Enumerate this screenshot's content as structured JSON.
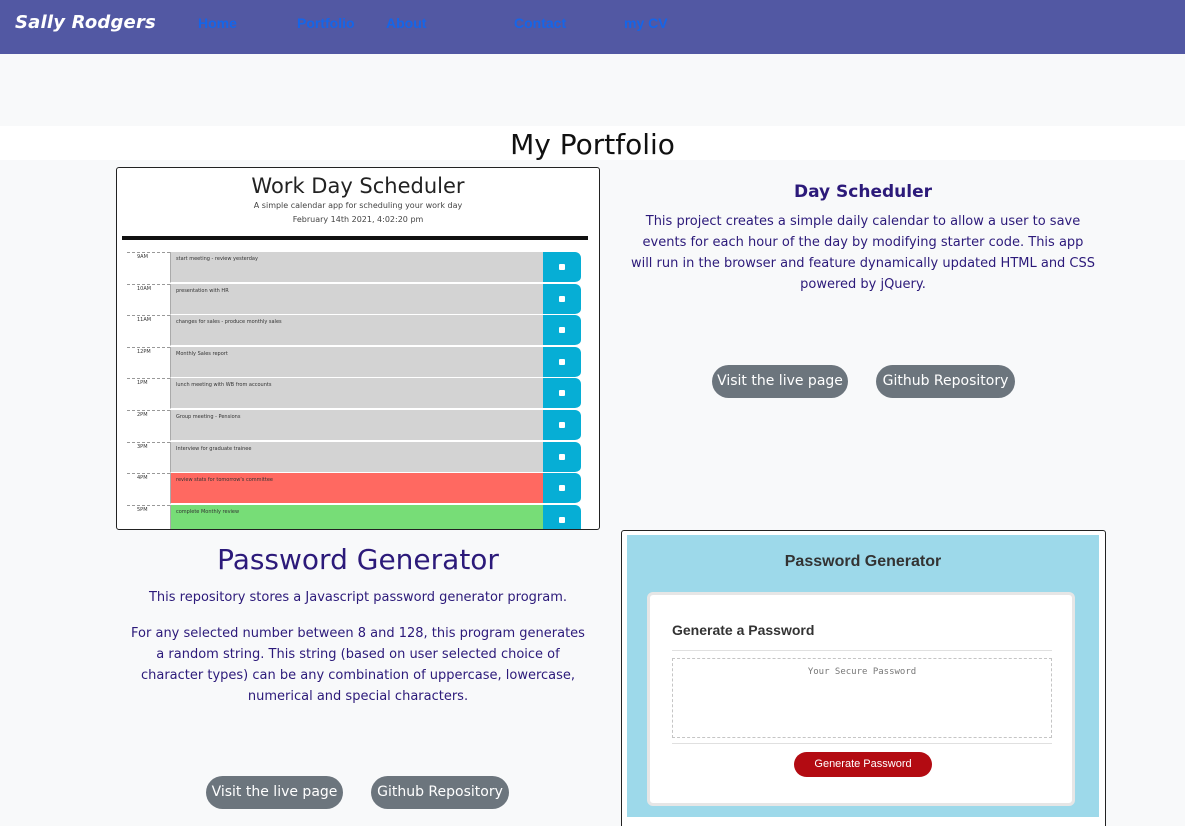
{
  "nav": {
    "brand": "Sally Rodgers",
    "links": [
      "Home",
      "Portfolio",
      "About",
      "Contact",
      "my CV"
    ]
  },
  "page": {
    "title": "My Portfolio"
  },
  "scheduler_preview": {
    "title": "Work Day Scheduler",
    "subtitle": "A simple calendar app for scheduling your work day",
    "date": "February 14th 2021, 4:02:20 pm",
    "rows": [
      {
        "hour": "9AM",
        "text": "start meeting - review yesterday",
        "state": "past"
      },
      {
        "hour": "10AM",
        "text": "presentation with HR",
        "state": "past"
      },
      {
        "hour": "11AM",
        "text": "changes for sales - produce monthly sales",
        "state": "past"
      },
      {
        "hour": "12PM",
        "text": "Monthly Sales report",
        "state": "past"
      },
      {
        "hour": "1PM",
        "text": "lunch meeting with WB from accounts",
        "state": "past"
      },
      {
        "hour": "2PM",
        "text": "Group meeting - Pensions",
        "state": "past"
      },
      {
        "hour": "3PM",
        "text": "Interview for graduate trainee",
        "state": "past"
      },
      {
        "hour": "4PM",
        "text": "review stats for tomorrow's committee",
        "state": "present"
      },
      {
        "hour": "5PM",
        "text": "complete Monthly review",
        "state": "future"
      }
    ]
  },
  "project1": {
    "title": "Day Scheduler",
    "description": "This project creates a simple daily calendar to allow a user to save events for each hour of the day by modifying starter code. This app will run in the browser and feature dynamically updated HTML and CSS powered by jQuery.",
    "live_button": "Visit the live page",
    "repo_button": "Github Repository"
  },
  "project2": {
    "title": "Password Generator",
    "description1": "This repository stores a Javascript password generator program.",
    "description2": "For any selected number between 8 and 128, this program generates a random string. This string (based on user selected choice of character types) can be any combination of uppercase, lowercase, numerical and special characters.",
    "live_button": "Visit the live page",
    "repo_button": "Github Repository"
  },
  "password_preview": {
    "header": "Password Generator",
    "card_title": "Generate a Password",
    "placeholder": "Your Secure Password",
    "button": "Generate Password"
  }
}
